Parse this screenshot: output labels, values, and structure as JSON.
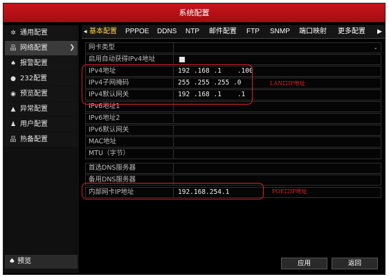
{
  "window": {
    "title": "系统配置"
  },
  "sidebar": {
    "items": [
      {
        "label": "通用配置",
        "icon": "gear-icon",
        "glyph": "✲"
      },
      {
        "label": "网络配置",
        "icon": "network-icon",
        "glyph": "品"
      },
      {
        "label": "报警配置",
        "icon": "alarm-icon",
        "glyph": "♠"
      },
      {
        "label": "232配置",
        "icon": "rs232-icon",
        "glyph": "●"
      },
      {
        "label": "预览配置",
        "icon": "preview-icon",
        "glyph": "◉"
      },
      {
        "label": "异常配置",
        "icon": "warning-icon",
        "glyph": "▲"
      },
      {
        "label": "用户配置",
        "icon": "user-icon",
        "glyph": "♟"
      },
      {
        "label": "热备配置",
        "icon": "hotspare-icon",
        "glyph": "品"
      }
    ],
    "active_index": 1,
    "preview_button": "预览"
  },
  "tabs": [
    "基本配置",
    "PPPOE",
    "DDNS",
    "NTP",
    "邮件配置",
    "FTP",
    "SNMP",
    "端口映射",
    "更多配置"
  ],
  "form": {
    "nic_type": {
      "label": "网卡类型",
      "value": ""
    },
    "dhcp": {
      "label": "启用自动获得IPv4地址",
      "checked": true
    },
    "ipv4_address": {
      "label": "IPv4地址",
      "value": "192 .168 .1    .100"
    },
    "ipv4_mask": {
      "label": "IPv4子网掩码",
      "value": "255 .255 .255 .0"
    },
    "ipv4_gateway": {
      "label": "IPv4默认网关",
      "value": "192 .168 .1    .1"
    },
    "ipv6_addr1": {
      "label": "IPv6地址1",
      "value": ""
    },
    "ipv6_addr2": {
      "label": "IPv6地址2",
      "value": ""
    },
    "ipv6_gateway": {
      "label": "IPv6默认网关",
      "value": ""
    },
    "mac": {
      "label": "MAC地址",
      "value": ""
    },
    "mtu": {
      "label": "MTU（字节）",
      "value": ""
    },
    "dns1": {
      "label": "首选DNS服务器",
      "value": ""
    },
    "dns2": {
      "label": "备用DNS服务器",
      "value": ""
    },
    "internal_nic": {
      "label": "内部网卡IP地址",
      "value": "192.168.254.1"
    }
  },
  "annotations": {
    "lan": "LAN口IP地址",
    "poe": "POE口IP地址",
    "color": "#e0202a"
  },
  "buttons": {
    "apply": "应用",
    "back": "返回"
  },
  "colors": {
    "titlebar": "#b5111a",
    "active_tab": "#ffd54a"
  }
}
